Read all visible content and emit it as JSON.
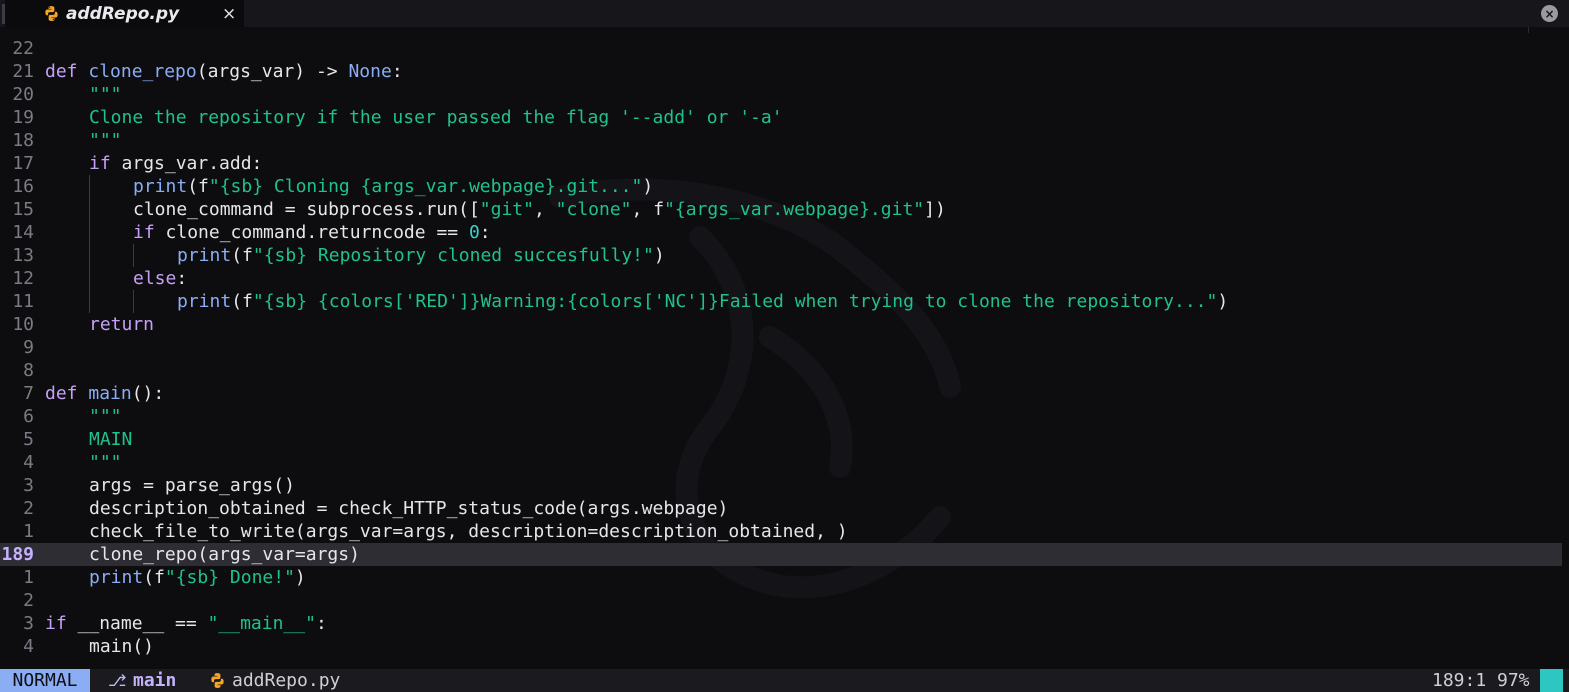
{
  "tab": {
    "title": "addRepo.py",
    "close_symbol": "×",
    "icon": "python-file-icon"
  },
  "window": {
    "close_symbol": "×"
  },
  "colors": {
    "keyword": "#c6a0f6",
    "function": "#8aadf4",
    "string": "#1fc28a",
    "number": "#3fd0c8",
    "mode_bg": "#8aadf4",
    "cursor": "#2ec6c0"
  },
  "lines": [
    {
      "n": "22",
      "indent": 0,
      "tokens": []
    },
    {
      "n": "21",
      "indent": 0,
      "tokens": [
        [
          "kw",
          "def "
        ],
        [
          "fn",
          "clone_repo"
        ],
        [
          "op",
          "(args_var) -> "
        ],
        [
          "fn",
          "None"
        ],
        [
          "op",
          ":"
        ]
      ]
    },
    {
      "n": "20",
      "indent": 1,
      "tokens": [
        [
          "str",
          "\"\"\""
        ]
      ]
    },
    {
      "n": "19",
      "indent": 1,
      "tokens": [
        [
          "str",
          "Clone the repository if the user passed the flag '--add' or '-a'"
        ]
      ]
    },
    {
      "n": "18",
      "indent": 1,
      "tokens": [
        [
          "str",
          "\"\"\""
        ]
      ]
    },
    {
      "n": "17",
      "indent": 1,
      "tokens": [
        [
          "kw",
          "if "
        ],
        [
          "op",
          "args_var.add:"
        ]
      ]
    },
    {
      "n": "16",
      "indent": 2,
      "tokens": [
        [
          "fn",
          "print"
        ],
        [
          "op",
          "(f"
        ],
        [
          "str",
          "\"{sb} Cloning {args_var.webpage}.git...\""
        ],
        [
          "op",
          ")"
        ]
      ]
    },
    {
      "n": "15",
      "indent": 2,
      "tokens": [
        [
          "op",
          "clone_command = subprocess.run(["
        ],
        [
          "str",
          "\"git\""
        ],
        [
          "op",
          ", "
        ],
        [
          "str",
          "\"clone\""
        ],
        [
          "op",
          ", f"
        ],
        [
          "str",
          "\"{args_var.webpage}.git\""
        ],
        [
          "op",
          "])"
        ]
      ]
    },
    {
      "n": "14",
      "indent": 2,
      "tokens": [
        [
          "kw",
          "if "
        ],
        [
          "op",
          "clone_command.returncode == "
        ],
        [
          "num",
          "0"
        ],
        [
          "op",
          ":"
        ]
      ]
    },
    {
      "n": "13",
      "indent": 3,
      "tokens": [
        [
          "fn",
          "print"
        ],
        [
          "op",
          "(f"
        ],
        [
          "str",
          "\"{sb} Repository cloned succesfully!\""
        ],
        [
          "op",
          ")"
        ]
      ]
    },
    {
      "n": "12",
      "indent": 2,
      "tokens": [
        [
          "kw",
          "else"
        ],
        [
          "op",
          ":"
        ]
      ]
    },
    {
      "n": "11",
      "indent": 3,
      "tokens": [
        [
          "fn",
          "print"
        ],
        [
          "op",
          "(f"
        ],
        [
          "str",
          "\"{sb} {colors['RED']}Warning:{colors['NC']}Failed when trying to clone the repository...\""
        ],
        [
          "op",
          ")"
        ]
      ]
    },
    {
      "n": "10",
      "indent": 1,
      "tokens": [
        [
          "kw",
          "return"
        ]
      ]
    },
    {
      "n": "9",
      "indent": 0,
      "tokens": []
    },
    {
      "n": "8",
      "indent": 0,
      "tokens": []
    },
    {
      "n": "7",
      "indent": 0,
      "tokens": [
        [
          "kw",
          "def "
        ],
        [
          "fn",
          "main"
        ],
        [
          "op",
          "():"
        ]
      ]
    },
    {
      "n": "6",
      "indent": 1,
      "tokens": [
        [
          "str",
          "\"\"\""
        ]
      ]
    },
    {
      "n": "5",
      "indent": 1,
      "tokens": [
        [
          "str",
          "MAIN"
        ]
      ]
    },
    {
      "n": "4",
      "indent": 1,
      "tokens": [
        [
          "str",
          "\"\"\""
        ]
      ]
    },
    {
      "n": "3",
      "indent": 1,
      "tokens": [
        [
          "op",
          "args = parse_args()"
        ]
      ]
    },
    {
      "n": "2",
      "indent": 1,
      "tokens": [
        [
          "op",
          "description_obtained = check_HTTP_status_code(args.webpage)"
        ]
      ]
    },
    {
      "n": "1",
      "indent": 1,
      "tokens": [
        [
          "op",
          "check_file_to_write(args_var=args, description=description_obtained, )"
        ]
      ]
    },
    {
      "n": "189",
      "indent": 1,
      "current": true,
      "tokens": [
        [
          "op",
          "clone_repo(args_var=args)"
        ]
      ]
    },
    {
      "n": "1",
      "indent": 1,
      "tokens": [
        [
          "fn",
          "print"
        ],
        [
          "op",
          "(f"
        ],
        [
          "str",
          "\"{sb} Done!\""
        ],
        [
          "op",
          ")"
        ]
      ]
    },
    {
      "n": "2",
      "indent": 0,
      "tokens": []
    },
    {
      "n": "3",
      "indent": 0,
      "tokens": [
        [
          "kw",
          "if "
        ],
        [
          "op",
          "__name__ == "
        ],
        [
          "str",
          "\"__main__\""
        ],
        [
          "op",
          ":"
        ]
      ]
    },
    {
      "n": "4",
      "indent": 1,
      "tokens": [
        [
          "op",
          "main()"
        ]
      ]
    }
  ],
  "status": {
    "mode": "NORMAL",
    "branch_icon": "git-branch-icon",
    "branch": "main",
    "file_icon": "python-file-icon",
    "filename": "addRepo.py",
    "position": "189:1",
    "percent": "97%"
  }
}
